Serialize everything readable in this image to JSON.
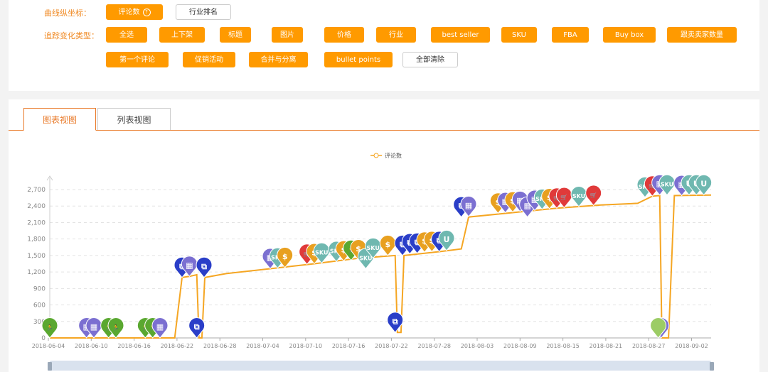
{
  "top": {
    "yaxis_label": "曲线纵坐标：",
    "yaxis_buttons": [
      {
        "label": "评论数",
        "active": true,
        "help": "?"
      },
      {
        "label": "行业排名",
        "active": false
      }
    ],
    "tracking_label": "追踪变化类型：",
    "tracking_buttons": [
      {
        "label": "全选",
        "active": true
      },
      {
        "label": "上下架",
        "active": true
      },
      {
        "label": "标题",
        "active": true
      },
      {
        "label": "图片",
        "active": true
      },
      {
        "label": "价格",
        "active": true
      },
      {
        "label": "行业",
        "active": true
      },
      {
        "label": "best seller",
        "active": true
      },
      {
        "label": "SKU",
        "active": true
      },
      {
        "label": "FBA",
        "active": true
      },
      {
        "label": "Buy box",
        "active": true
      },
      {
        "label": "跟卖卖家数量",
        "active": true
      },
      {
        "label": "第一个评论",
        "active": true
      },
      {
        "label": "促销活动",
        "active": true
      },
      {
        "label": "合并与分离",
        "active": true
      },
      {
        "label": "bullet points",
        "active": true
      },
      {
        "label": "全部清除",
        "active": false
      }
    ]
  },
  "tabs": [
    {
      "label": "图表视图",
      "active": true
    },
    {
      "label": "列表视图",
      "active": false
    }
  ],
  "chart_data": {
    "type": "line",
    "legend": "评论数",
    "line_color": "#f5a623",
    "x_ticks": [
      "2018-06-04",
      "2018-06-10",
      "2018-06-16",
      "2018-06-22",
      "2018-06-28",
      "2018-07-04",
      "2018-07-10",
      "2018-07-16",
      "2018-07-22",
      "2018-07-28",
      "2018-08-03",
      "2018-08-09",
      "2018-08-15",
      "2018-08-21",
      "2018-08-27",
      "2018-09-02"
    ],
    "y_ticks": [
      "0",
      "300",
      "600",
      "900",
      "1,200",
      "1,500",
      "1,800",
      "2,100",
      "2,400",
      "2,700"
    ],
    "ylim": [
      0,
      2700
    ],
    "grid": true,
    "series": [
      {
        "name": "评论数",
        "points": [
          [
            0,
            0
          ],
          [
            10,
            0
          ],
          [
            17,
            0
          ],
          [
            18,
            1100
          ],
          [
            19,
            1120
          ],
          [
            20,
            1150
          ],
          [
            20.3,
            0
          ],
          [
            20.7,
            0
          ],
          [
            21.1,
            1100
          ],
          [
            24,
            1170
          ],
          [
            30,
            1260
          ],
          [
            36,
            1350
          ],
          [
            42,
            1450
          ],
          [
            47,
            1500
          ],
          [
            47.3,
            100
          ],
          [
            47.8,
            100
          ],
          [
            48.2,
            1500
          ],
          [
            53,
            1570
          ],
          [
            56,
            1620
          ],
          [
            57,
            2200
          ],
          [
            63,
            2280
          ],
          [
            69,
            2360
          ],
          [
            75,
            2420
          ],
          [
            80,
            2450
          ],
          [
            82,
            2580
          ],
          [
            83,
            2590
          ],
          [
            83.3,
            0
          ],
          [
            84.2,
            0
          ],
          [
            85,
            2590
          ],
          [
            90,
            2600
          ]
        ]
      }
    ],
    "events": [
      {
        "day": 0,
        "value": 0,
        "type": "promotion",
        "color": "#5aa830",
        "icon": "🏃"
      },
      {
        "day": 5,
        "value": 0,
        "type": "bullet points",
        "color": "#7b6fd1",
        "icon": "▦"
      },
      {
        "day": 6,
        "value": 0,
        "type": "bullet points",
        "color": "#7b6fd1",
        "icon": "▦"
      },
      {
        "day": 8,
        "value": 0,
        "type": "promotion",
        "color": "#5aa830",
        "icon": "🏃"
      },
      {
        "day": 9,
        "value": 0,
        "type": "promotion",
        "color": "#5aa830",
        "icon": "🏃"
      },
      {
        "day": 13,
        "value": 0,
        "type": "promotion",
        "color": "#5aa830",
        "icon": "🏃"
      },
      {
        "day": 14,
        "value": 0,
        "type": "promotion",
        "color": "#5aa830",
        "icon": "🏃"
      },
      {
        "day": 15,
        "value": 0,
        "type": "bullet points",
        "color": "#7b6fd1",
        "icon": "▦"
      },
      {
        "day": 18,
        "value": 1100,
        "type": "merge/split",
        "color": "#2a3ec8",
        "icon": "⧉"
      },
      {
        "day": 19,
        "value": 1120,
        "type": "bullet points",
        "color": "#7b6fd1",
        "icon": "▦"
      },
      {
        "day": 20,
        "value": 0,
        "type": "merge/split",
        "color": "#2a3ec8",
        "icon": "⧉"
      },
      {
        "day": 21,
        "value": 1100,
        "type": "merge/split",
        "color": "#2a3ec8",
        "icon": "⧉"
      },
      {
        "day": 30,
        "value": 1260,
        "type": "bullet points",
        "color": "#7b6fd1",
        "icon": "▦"
      },
      {
        "day": 31,
        "value": 1270,
        "type": "SKU",
        "color": "#6fb8b0",
        "icon": "SKU"
      },
      {
        "day": 32,
        "value": 1280,
        "type": "price",
        "color": "#e8a020",
        "icon": "$"
      },
      {
        "day": 35,
        "value": 1340,
        "type": "buy box",
        "color": "#e03a3a",
        "icon": "🛒"
      },
      {
        "day": 36,
        "value": 1350,
        "type": "price",
        "color": "#e8a020",
        "icon": "$"
      },
      {
        "day": 37,
        "value": 1360,
        "type": "SKU",
        "color": "#6fb8b0",
        "icon": "SKU"
      },
      {
        "day": 39,
        "value": 1390,
        "type": "SKU",
        "color": "#6fb8b0",
        "icon": "SKU"
      },
      {
        "day": 40,
        "value": 1400,
        "type": "price",
        "color": "#e8a020",
        "icon": "$"
      },
      {
        "day": 41,
        "value": 1410,
        "type": "promotion",
        "color": "#5aa830",
        "icon": "🏃"
      },
      {
        "day": 42,
        "value": 1420,
        "type": "price",
        "color": "#e8a020",
        "icon": "$"
      },
      {
        "day": 43,
        "value": 1260,
        "type": "SKU",
        "color": "#6fb8b0",
        "icon": "SKU"
      },
      {
        "day": 44,
        "value": 1450,
        "type": "SKU",
        "color": "#6fb8b0",
        "icon": "SKU"
      },
      {
        "day": 46,
        "value": 1500,
        "type": "price",
        "color": "#e8a020",
        "icon": "$"
      },
      {
        "day": 47,
        "value": 100,
        "type": "merge/split",
        "color": "#2a3ec8",
        "icon": "⧉"
      },
      {
        "day": 48,
        "value": 1500,
        "type": "merge/split",
        "color": "#2a3ec8",
        "icon": "⧉"
      },
      {
        "day": 49,
        "value": 1530,
        "type": "merge/split",
        "color": "#2a3ec8",
        "icon": "⧉"
      },
      {
        "day": 50,
        "value": 1540,
        "type": "merge/split",
        "color": "#2a3ec8",
        "icon": "⧉"
      },
      {
        "day": 51,
        "value": 1560,
        "type": "price",
        "color": "#e8a020",
        "icon": "$"
      },
      {
        "day": 52,
        "value": 1570,
        "type": "price",
        "color": "#e8a020",
        "icon": "$"
      },
      {
        "day": 53,
        "value": 1570,
        "type": "merge/split",
        "color": "#2a3ec8",
        "icon": "⧉"
      },
      {
        "day": 54,
        "value": 1590,
        "type": "SKU",
        "color": "#6fb8b0",
        "icon": "U"
      },
      {
        "day": 56,
        "value": 2200,
        "type": "merge/split",
        "color": "#2a3ec8",
        "icon": "⧉"
      },
      {
        "day": 57,
        "value": 2210,
        "type": "bullet points",
        "color": "#7b6fd1",
        "icon": "▦"
      },
      {
        "day": 61,
        "value": 2270,
        "type": "price",
        "color": "#e8a020",
        "icon": "$"
      },
      {
        "day": 62,
        "value": 2280,
        "type": "bullet points",
        "color": "#7b6fd1",
        "icon": "▦"
      },
      {
        "day": 63,
        "value": 2290,
        "type": "price",
        "color": "#e8a020",
        "icon": "$"
      },
      {
        "day": 64,
        "value": 2300,
        "type": "bullet points",
        "color": "#7b6fd1",
        "icon": "▦"
      },
      {
        "day": 65,
        "value": 2200,
        "type": "bullet points",
        "color": "#7b6fd1",
        "icon": "▦"
      },
      {
        "day": 66,
        "value": 2320,
        "type": "bullet points",
        "color": "#7b6fd1",
        "icon": "▦"
      },
      {
        "day": 67,
        "value": 2340,
        "type": "SKU",
        "color": "#6fb8b0",
        "icon": "SKU"
      },
      {
        "day": 68,
        "value": 2350,
        "type": "price",
        "color": "#e8a020",
        "icon": "$"
      },
      {
        "day": 69,
        "value": 2360,
        "type": "buy box",
        "color": "#e03a3a",
        "icon": "🛒"
      },
      {
        "day": 70,
        "value": 2370,
        "type": "buy box",
        "color": "#e03a3a",
        "icon": "🛒"
      },
      {
        "day": 72,
        "value": 2390,
        "type": "SKU",
        "color": "#6fb8b0",
        "icon": "SKU"
      },
      {
        "day": 74,
        "value": 2410,
        "type": "buy box",
        "color": "#e03a3a",
        "icon": "🛒"
      },
      {
        "day": 81,
        "value": 2560,
        "type": "SKU",
        "color": "#6fb8b0",
        "icon": "SKU"
      },
      {
        "day": 82,
        "value": 2580,
        "type": "buy box",
        "color": "#e03a3a",
        "icon": "🛒"
      },
      {
        "day": 83,
        "value": 2600,
        "type": "bullet points",
        "color": "#7b6fd1",
        "icon": "▦"
      },
      {
        "day": 84,
        "value": 2600,
        "type": "SKU",
        "color": "#6fb8b0",
        "icon": "SKU"
      },
      {
        "day": 83.2,
        "value": 0,
        "type": "bullet points",
        "color": "#7b6fd1",
        "icon": "▦"
      },
      {
        "day": 82.8,
        "value": 0,
        "type": "first review",
        "color": "#9ccc65",
        "icon": ""
      },
      {
        "day": 86,
        "value": 2590,
        "type": "bullet points",
        "color": "#7b6fd1",
        "icon": "▦"
      },
      {
        "day": 87,
        "value": 2600,
        "type": "SKU",
        "color": "#6fb8b0",
        "icon": "U"
      },
      {
        "day": 88,
        "value": 2600,
        "type": "SKU",
        "color": "#6fb8b0",
        "icon": "U"
      },
      {
        "day": 89,
        "value": 2600,
        "type": "SKU",
        "color": "#6fb8b0",
        "icon": "U"
      }
    ]
  }
}
